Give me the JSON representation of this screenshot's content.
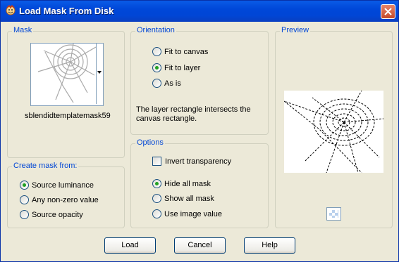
{
  "window": {
    "title": "Load Mask From Disk"
  },
  "mask": {
    "label": "Mask",
    "name": "sblendidtemplatemask59"
  },
  "create_from": {
    "label": "Create mask from:",
    "options": [
      "Source luminance",
      "Any non-zero value",
      "Source opacity"
    ],
    "selected": 0
  },
  "orientation": {
    "label": "Orientation",
    "options": [
      "Fit to canvas",
      "Fit to layer",
      "As is"
    ],
    "selected": 1,
    "info": "The layer rectangle intersects the canvas rectangle."
  },
  "options": {
    "label": "Options",
    "invert_label": "Invert transparency",
    "invert_checked": false,
    "mask_options": [
      "Hide all mask",
      "Show all mask",
      "Use image value"
    ],
    "selected": 0
  },
  "preview": {
    "label": "Preview"
  },
  "buttons": {
    "load": "Load",
    "cancel": "Cancel",
    "help": "Help"
  },
  "colors": {
    "title_bar": "#0046d6",
    "group_label": "#0046d5",
    "dialog_bg": "#ece9d8"
  }
}
